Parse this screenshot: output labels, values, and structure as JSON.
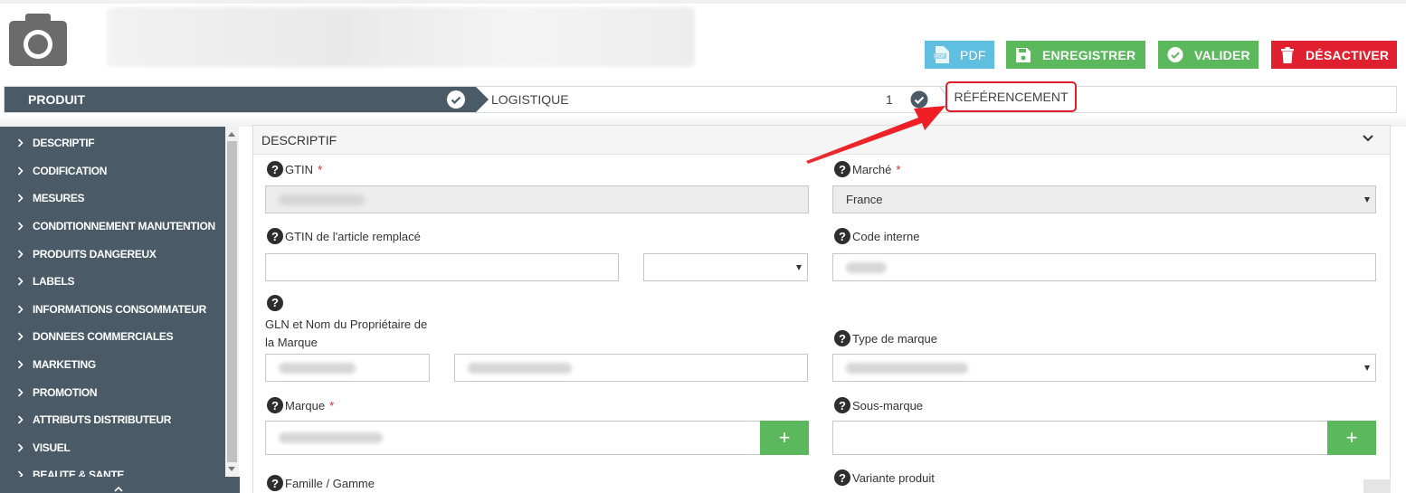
{
  "header": {
    "buttons": {
      "pdf": "PDF",
      "save": "ENREGISTRER",
      "validate": "VALIDER",
      "deactivate": "DÉSACTIVER"
    }
  },
  "tabs": {
    "produit": "PRODUIT",
    "logistique": "LOGISTIQUE",
    "logistique_count": "1",
    "referencement": "RÉFÉRENCEMENT"
  },
  "sidebar": {
    "items": [
      {
        "label": "DESCRIPTIF"
      },
      {
        "label": "CODIFICATION"
      },
      {
        "label": "MESURES"
      },
      {
        "label": "CONDITIONNEMENT MANUTENTION"
      },
      {
        "label": "PRODUITS DANGEREUX"
      },
      {
        "label": "LABELS"
      },
      {
        "label": "INFORMATIONS CONSOMMATEUR"
      },
      {
        "label": "DONNEES COMMERCIALES"
      },
      {
        "label": "MARKETING"
      },
      {
        "label": "PROMOTION"
      },
      {
        "label": "ATTRIBUTS DISTRIBUTEUR"
      },
      {
        "label": "VISUEL"
      },
      {
        "label": "BEAUTE & SANTE"
      }
    ]
  },
  "panel": {
    "title": "DESCRIPTIF",
    "fields": {
      "gtin": {
        "label": "GTIN",
        "required": "*"
      },
      "marche": {
        "label": "Marché",
        "required": "*",
        "value": "France"
      },
      "gtin_remplace": {
        "label": "GTIN de l'article remplacé"
      },
      "code_interne": {
        "label": "Code interne"
      },
      "gln_line1": "GLN et Nom du Propriétaire de",
      "gln_line2": "la Marque",
      "type_marque": {
        "label": "Type de marque"
      },
      "marque": {
        "label": "Marque",
        "required": "*"
      },
      "sous_marque": {
        "label": "Sous-marque"
      },
      "famille": {
        "label": "Famille / Gamme"
      },
      "variante": {
        "label": "Variante produit"
      }
    },
    "plus_symbol": "+"
  },
  "colors": {
    "sidebar_bg": "#4a5a66",
    "pdf": "#5ebfe0",
    "green": "#5cb85c",
    "red": "#e0202e",
    "highlight": "#e21d2a"
  },
  "icons": [
    "camera-icon",
    "pdf-icon",
    "save-icon",
    "check-circle-icon",
    "trash-icon",
    "chevron-right-icon",
    "chevron-down-icon",
    "help-icon",
    "plus-icon"
  ]
}
